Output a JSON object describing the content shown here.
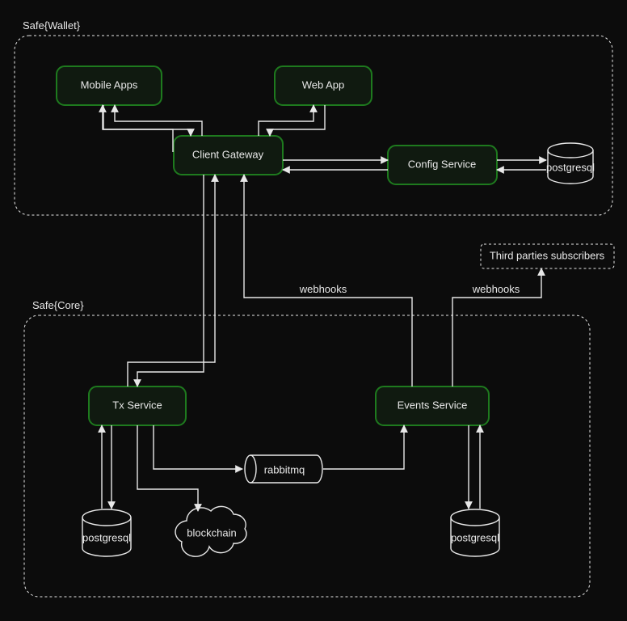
{
  "groups": {
    "wallet": {
      "label": "Safe{Wallet}"
    },
    "core": {
      "label": "Safe{Core}"
    }
  },
  "nodes": {
    "mobile_apps": {
      "label": "Mobile Apps"
    },
    "web_app": {
      "label": "Web App"
    },
    "client_gateway": {
      "label": "Client Gateway"
    },
    "config_service": {
      "label": "Config Service"
    },
    "postgres_cfg": {
      "label": "postgresql"
    },
    "third_parties": {
      "label": "Third parties subscribers"
    },
    "tx_service": {
      "label": "Tx Service"
    },
    "events_service": {
      "label": "Events Service"
    },
    "rabbitmq": {
      "label": "rabbitmq"
    },
    "postgres_tx": {
      "label": "postgresql"
    },
    "blockchain": {
      "label": "blockchain"
    },
    "postgres_ev": {
      "label": "postgresql"
    }
  },
  "edges": {
    "webhooks_1": {
      "label": "webhooks"
    },
    "webhooks_2": {
      "label": "webhooks"
    }
  }
}
